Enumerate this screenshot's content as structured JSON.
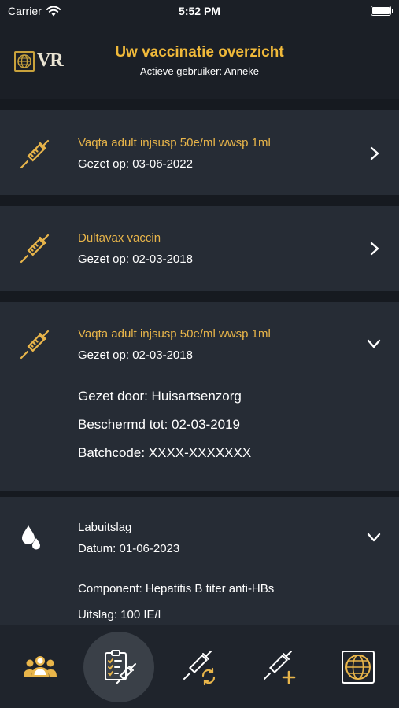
{
  "status": {
    "carrier": "Carrier",
    "time": "5:52 PM"
  },
  "header": {
    "logo_text": "VR",
    "title": "Uw vaccinatie overzicht",
    "subtitle": "Actieve gebruiker: Anneke"
  },
  "cards": [
    {
      "icon": "syringe-icon",
      "title": "Vaqta adult injsusp 50e/ml wwsp 1ml",
      "date": "Gezet op: 03-06-2022",
      "state": "collapsed"
    },
    {
      "icon": "syringe-icon",
      "title": "Dultavax vaccin",
      "date": "Gezet op: 02-03-2018",
      "state": "collapsed"
    },
    {
      "icon": "syringe-icon",
      "title": "Vaqta adult injsusp 50e/ml wwsp 1ml",
      "date": "Gezet op: 02-03-2018",
      "state": "expanded",
      "details": {
        "given_by": "Gezet door:  Huisartsenzorg",
        "protected_until": "Beschermd tot: 02-03-2019",
        "batchcode": "Batchcode: XXXX-XXXXXXX"
      }
    },
    {
      "icon": "drops-icon",
      "title": "Labuitslag",
      "date": "Datum: 01-06-2023",
      "state": "expanded",
      "details": {
        "component": "Component: Hepatitis B titer anti-HBs",
        "result": "Uitslag: 100 IE/l"
      }
    }
  ],
  "tabs": [
    {
      "name": "users-tab",
      "icon": "users-icon",
      "active": false
    },
    {
      "name": "overview-tab",
      "icon": "checklist-syringe-icon",
      "active": true
    },
    {
      "name": "refresh-vaccine-tab",
      "icon": "syringe-refresh-icon",
      "active": false
    },
    {
      "name": "add-vaccine-tab",
      "icon": "syringe-plus-icon",
      "active": false
    },
    {
      "name": "globe-tab",
      "icon": "globe-icon",
      "active": false
    }
  ],
  "colors": {
    "accent": "#e8b54a",
    "background": "#161a20",
    "card": "#262c35",
    "header": "#1b1f26"
  }
}
